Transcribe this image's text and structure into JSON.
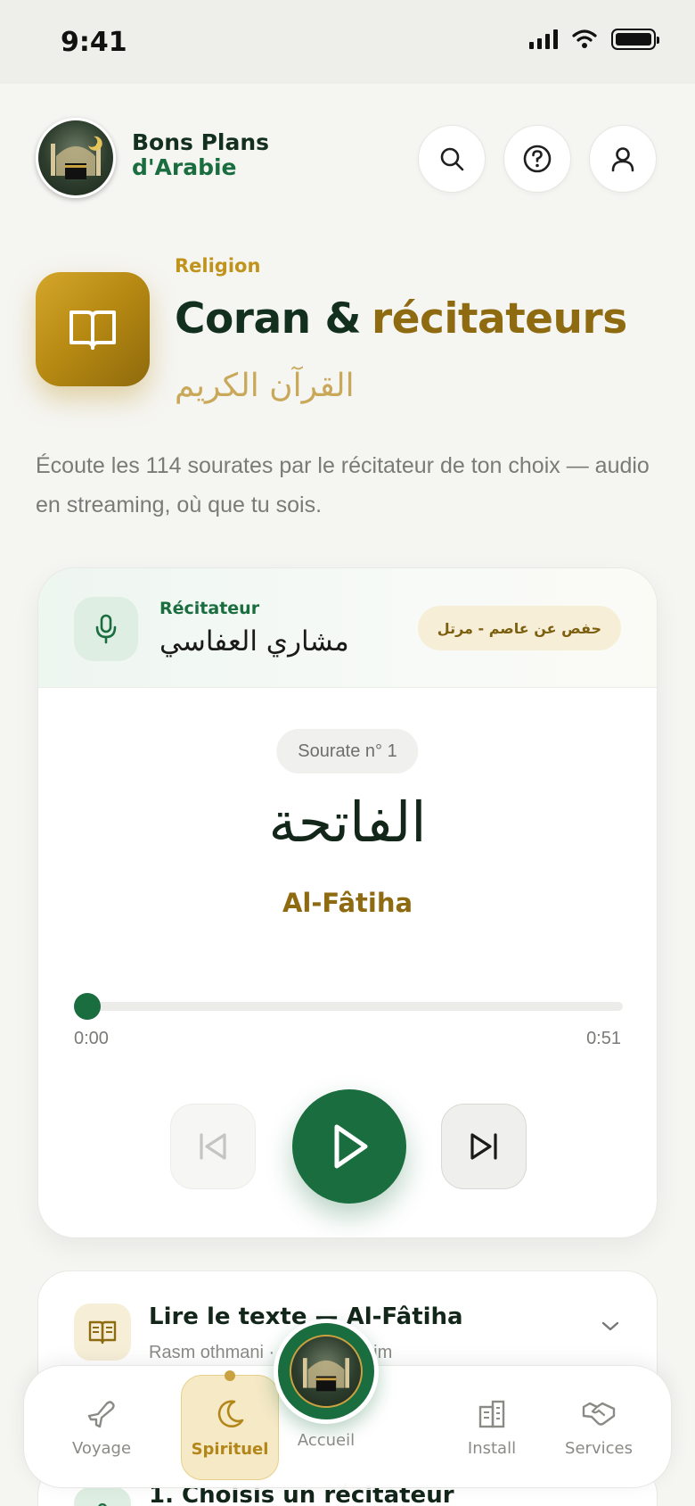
{
  "status": {
    "time": "9:41"
  },
  "header": {
    "brand_line1": "Bons Plans",
    "brand_line2": "d'Arabie"
  },
  "hero": {
    "eyebrow": "Religion",
    "title_part1": "Coran &",
    "title_part2": "récitateurs",
    "arabic": "القرآن الكريم",
    "description": "Écoute les 114 sourates par le récitateur de ton choix — audio en streaming, où que tu sois."
  },
  "player": {
    "reciter_label": "Récitateur",
    "reciter_name": "مشاري العفاسي",
    "riwaya": "حفص عن عاصم - مرتل",
    "sourate_badge": "Sourate n° 1",
    "sourate_arabic": "الفاتحة",
    "sourate_latin": "Al-Fâtiha",
    "time_current": "0:00",
    "time_total": "0:51",
    "progress": 0.0
  },
  "read_card": {
    "title": "Lire le texte — Al-Fâtiha",
    "subtitle": "Rasm othmani · Hafs 'an 'Asim"
  },
  "step_card": {
    "title": "1. Choisis un récitateur"
  },
  "nav": {
    "voyage": "Voyage",
    "spirituel": "Spirituel",
    "accueil": "Accueil",
    "install": "Install",
    "services": "Services"
  },
  "colors": {
    "brand_green": "#1a6d3e",
    "gold": "#8e6a10",
    "gold_light": "#c0941c"
  }
}
